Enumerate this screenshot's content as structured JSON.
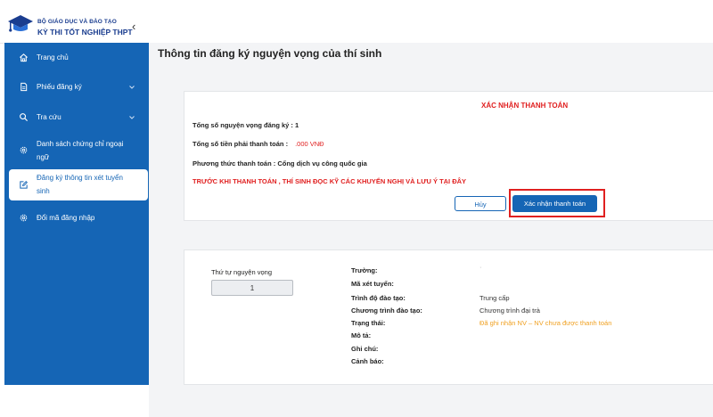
{
  "header": {
    "org": "BỘ GIÁO DỤC VÀ ĐÀO TẠO",
    "system": "KỲ THI TỐT NGHIỆP THPT",
    "collapse_icon": "‹"
  },
  "sidebar": {
    "items": [
      {
        "label": "Trang chủ",
        "icon": "home-icon"
      },
      {
        "label": "Phiếu đăng ký",
        "icon": "document-icon",
        "has_chevron": true
      },
      {
        "label": "Tra cứu",
        "icon": "search-icon",
        "has_chevron": true
      },
      {
        "label": "Danh sách chứng chỉ ngoại ngữ",
        "label_line1": "Danh sách chứng chỉ ngoại",
        "label_line2": "ngữ",
        "icon": "gear-icon"
      },
      {
        "label": "Đăng ký thông tin xét tuyển sinh",
        "label_line1": "Đăng ký thông tin xét tuyển",
        "label_line2": "sinh",
        "icon": "edit-icon",
        "active": true
      },
      {
        "label": "Đổi mã đăng nhập",
        "icon": "gear-icon"
      }
    ]
  },
  "page": {
    "title": "Thông tin đăng ký nguyện vọng của thí sinh"
  },
  "payment": {
    "title": "XÁC NHẬN THANH TOÁN",
    "total_wishes_label": "Tổng số nguyện vọng đăng ký : 1",
    "total_amount_label": "Tổng số tiền phải thanh toán :",
    "total_amount_value": ".000 VNĐ",
    "method_label": "Phương thức thanh toán : Cổng dịch vụ công quốc gia",
    "warning": "TRƯỚC KHI THANH TOÁN , THÍ SINH ĐỌC KỸ CÁC KHUYẾN NGHỊ VÀ LƯU Ý",
    "warning_link": "TẠI ĐÂY",
    "cancel_label": "Hủy",
    "confirm_label": "Xác nhận thanh toán"
  },
  "wish": {
    "order_label": "Thứ tự nguyện vọng",
    "order_value": "1",
    "fields": [
      {
        "label": "Trường:",
        "value": "·"
      },
      {
        "label": "Mã xét tuyển:",
        "value": ""
      },
      {
        "label": "Trình độ đào tạo:",
        "value": "Trung cấp"
      },
      {
        "label": "Chương trình đào tạo:",
        "value": "Chương trình đại trà"
      },
      {
        "label": "Trạng thái:",
        "value": "Đã ghi nhận NV – NV chưa được thanh toán"
      },
      {
        "label": "Mô tả:",
        "value": ""
      },
      {
        "label": "Ghi chú:",
        "value": ""
      },
      {
        "label": "Cảnh báo:",
        "value": ""
      }
    ]
  },
  "colors": {
    "sidebar_bg": "#1565b5",
    "primary": "#1565b5",
    "danger": "#e02020",
    "status_orange": "#f0a020"
  }
}
